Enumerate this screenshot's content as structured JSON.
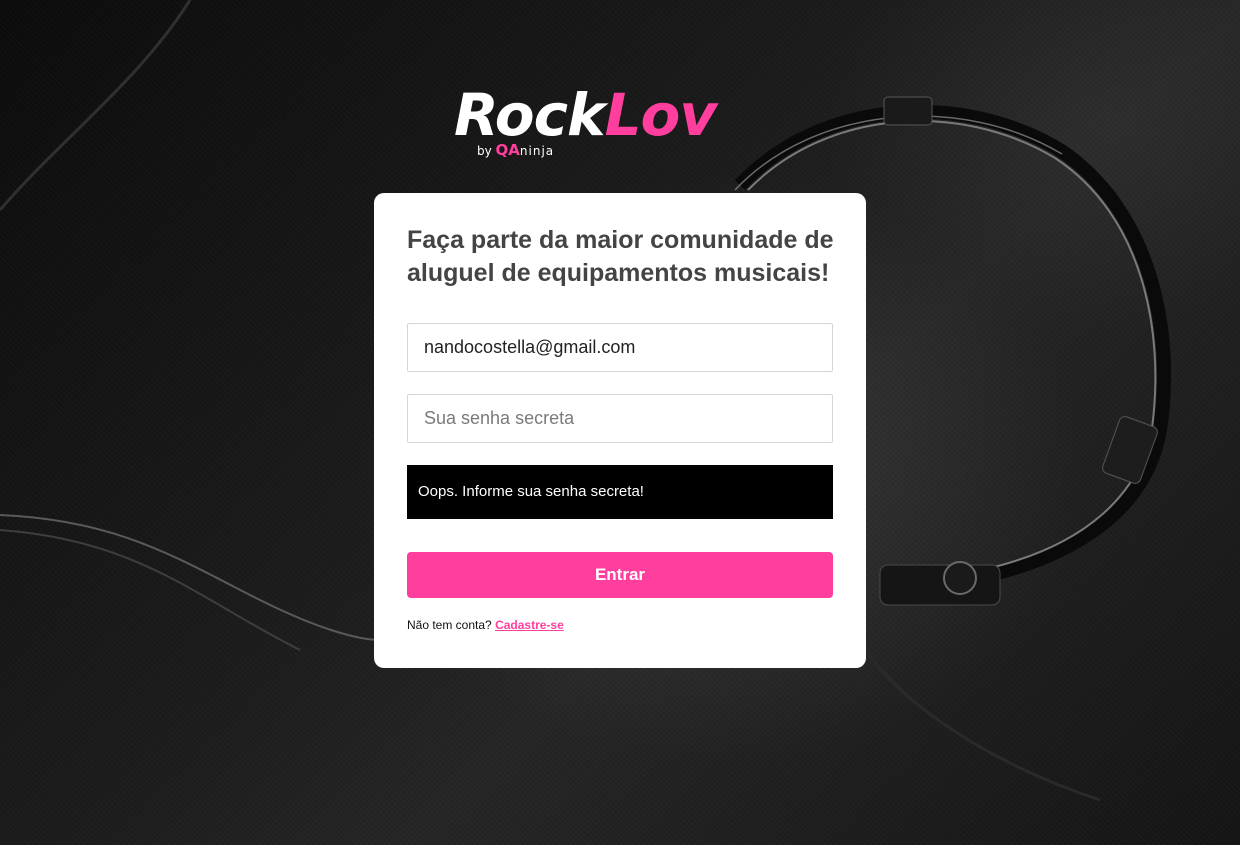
{
  "brand": {
    "logo_part1": "Rock",
    "logo_part2": "Lov",
    "by": "by",
    "qa": "QA",
    "ninja": "ninja",
    "color_accent": "#ff3e9d"
  },
  "login": {
    "title": "Faça parte da maior comunidade de aluguel de equipamentos musicais!",
    "email_value": "nandocostella@gmail.com",
    "password_placeholder": "Sua senha secreta",
    "alert_message": "Oops. Informe sua senha secreta!",
    "submit_label": "Entrar",
    "signup_prompt": "Não tem conta?",
    "signup_link": "Cadastre-se"
  }
}
